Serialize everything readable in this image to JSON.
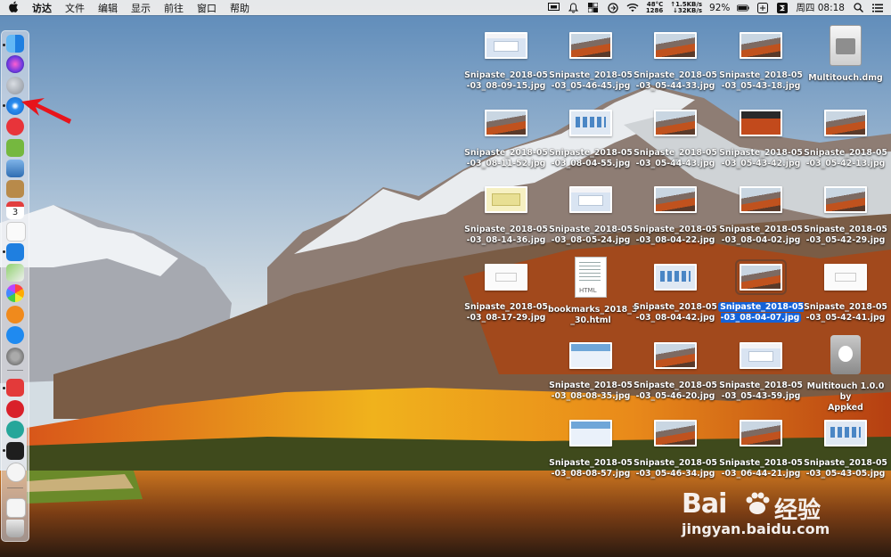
{
  "menubar": {
    "apple": "",
    "items": [
      "访达",
      "文件",
      "编辑",
      "显示",
      "前往",
      "窗口",
      "帮助"
    ],
    "status": {
      "cpu_temp": "48°C",
      "cpu_rpm": "1286",
      "net_up": "↑1.5KB/s",
      "net_down": "↓32KB/s",
      "battery": "92%",
      "datetime": "周四 08:18"
    }
  },
  "dock": {
    "items": [
      "finder",
      "siri",
      "launchpad",
      "safari",
      "toutiao",
      "android-studio",
      "preview",
      "notes",
      "calendar",
      "reminders",
      "contacts",
      "maps",
      "photos",
      "ibooks",
      "app-store",
      "system-preferences",
      "vivaldi",
      "netease-music",
      "app-2",
      "terminal",
      "baidu-netdisk",
      "downloads",
      "trash"
    ],
    "calendar_day": "3"
  },
  "desktop": {
    "items": [
      {
        "label": "Snipaste_2018-05\n-03_08-09-15.jpg",
        "thumb": "t-screen"
      },
      {
        "label": "Snipaste_2018-05\n-03_05-46-45.jpg",
        "thumb": "t-mtn"
      },
      {
        "label": "Snipaste_2018-05\n-03_05-44-33.jpg",
        "thumb": "t-mtn"
      },
      {
        "label": "Snipaste_2018-05\n-03_05-43-18.jpg",
        "thumb": "t-mtn"
      },
      {
        "label": "Multitouch.dmg",
        "big": "dmg"
      },
      {
        "label": "Snipaste_2018-05\n-03_08-11-52.jpg",
        "thumb": "t-mtn"
      },
      {
        "label": "Snipaste_2018-05\n-03_08-04-55.jpg",
        "thumb": "t-icons"
      },
      {
        "label": "Snipaste_2018-05\n-03_05-44-43.jpg",
        "thumb": "t-mtn"
      },
      {
        "label": "Snipaste_2018-05\n-03_05-43-42.jpg",
        "thumb": "t-dark"
      },
      {
        "label": "Snipaste_2018-05\n-03_05-42-13.jpg",
        "thumb": "t-mtn"
      },
      {
        "label": "Snipaste_2018-05\n-03_08-14-36.jpg",
        "thumb": "t-yellow"
      },
      {
        "label": "Snipaste_2018-05\n-03_08-05-24.jpg",
        "thumb": "t-screen"
      },
      {
        "label": "Snipaste_2018-05\n-03_08-04-22.jpg",
        "thumb": "t-mtn"
      },
      {
        "label": "Snipaste_2018-05\n-03_08-04-02.jpg",
        "thumb": "t-mtn"
      },
      {
        "label": "Snipaste_2018-05\n-03_05-42-29.jpg",
        "thumb": "t-mtn"
      },
      {
        "label": "Snipaste_2018-05\n-03_08-17-29.jpg",
        "thumb": "t-white"
      },
      {
        "label": "bookmarks_2018_3\n_30.html",
        "big": "html",
        "tag": "HTML"
      },
      {
        "label": "Snipaste_2018-05\n-03_08-04-42.jpg",
        "thumb": "t-icons"
      },
      {
        "label": "Snipaste_2018-05\n-03_08-04-07.jpg",
        "thumb": "t-mtn",
        "selected": true
      },
      {
        "label": "Snipaste_2018-05\n-03_05-42-41.jpg",
        "thumb": "t-white"
      },
      {
        "label": "Snipaste_2018-05\n-03_08-08-35.jpg",
        "thumb": "t-blue"
      },
      {
        "label": "Snipaste_2018-05\n-03_05-46-20.jpg",
        "thumb": "t-mtn"
      },
      {
        "label": "Snipaste_2018-05\n-03_05-43-59.jpg",
        "thumb": "t-screen"
      },
      {
        "label": "Multitouch 1.0.0 by\nAppked",
        "big": "app"
      },
      {
        "label": "Snipaste_2018-05\n-03_08-08-57.jpg",
        "thumb": "t-blue"
      },
      {
        "label": "Snipaste_2018-05\n-03_05-46-34.jpg",
        "thumb": "t-mtn"
      },
      {
        "label": "Snipaste_2018-05\n-03_06-44-21.jpg",
        "thumb": "t-mtn"
      },
      {
        "label": "Snipaste_2018-05\n-03_05-43-05.jpg",
        "thumb": "t-icons"
      }
    ]
  },
  "watermark": {
    "brand": "Bai",
    "brand2": "经验",
    "url": "jingyan.baidu.com"
  },
  "colors": {
    "selection": "#1462d8",
    "arrow": "#e8141b"
  }
}
